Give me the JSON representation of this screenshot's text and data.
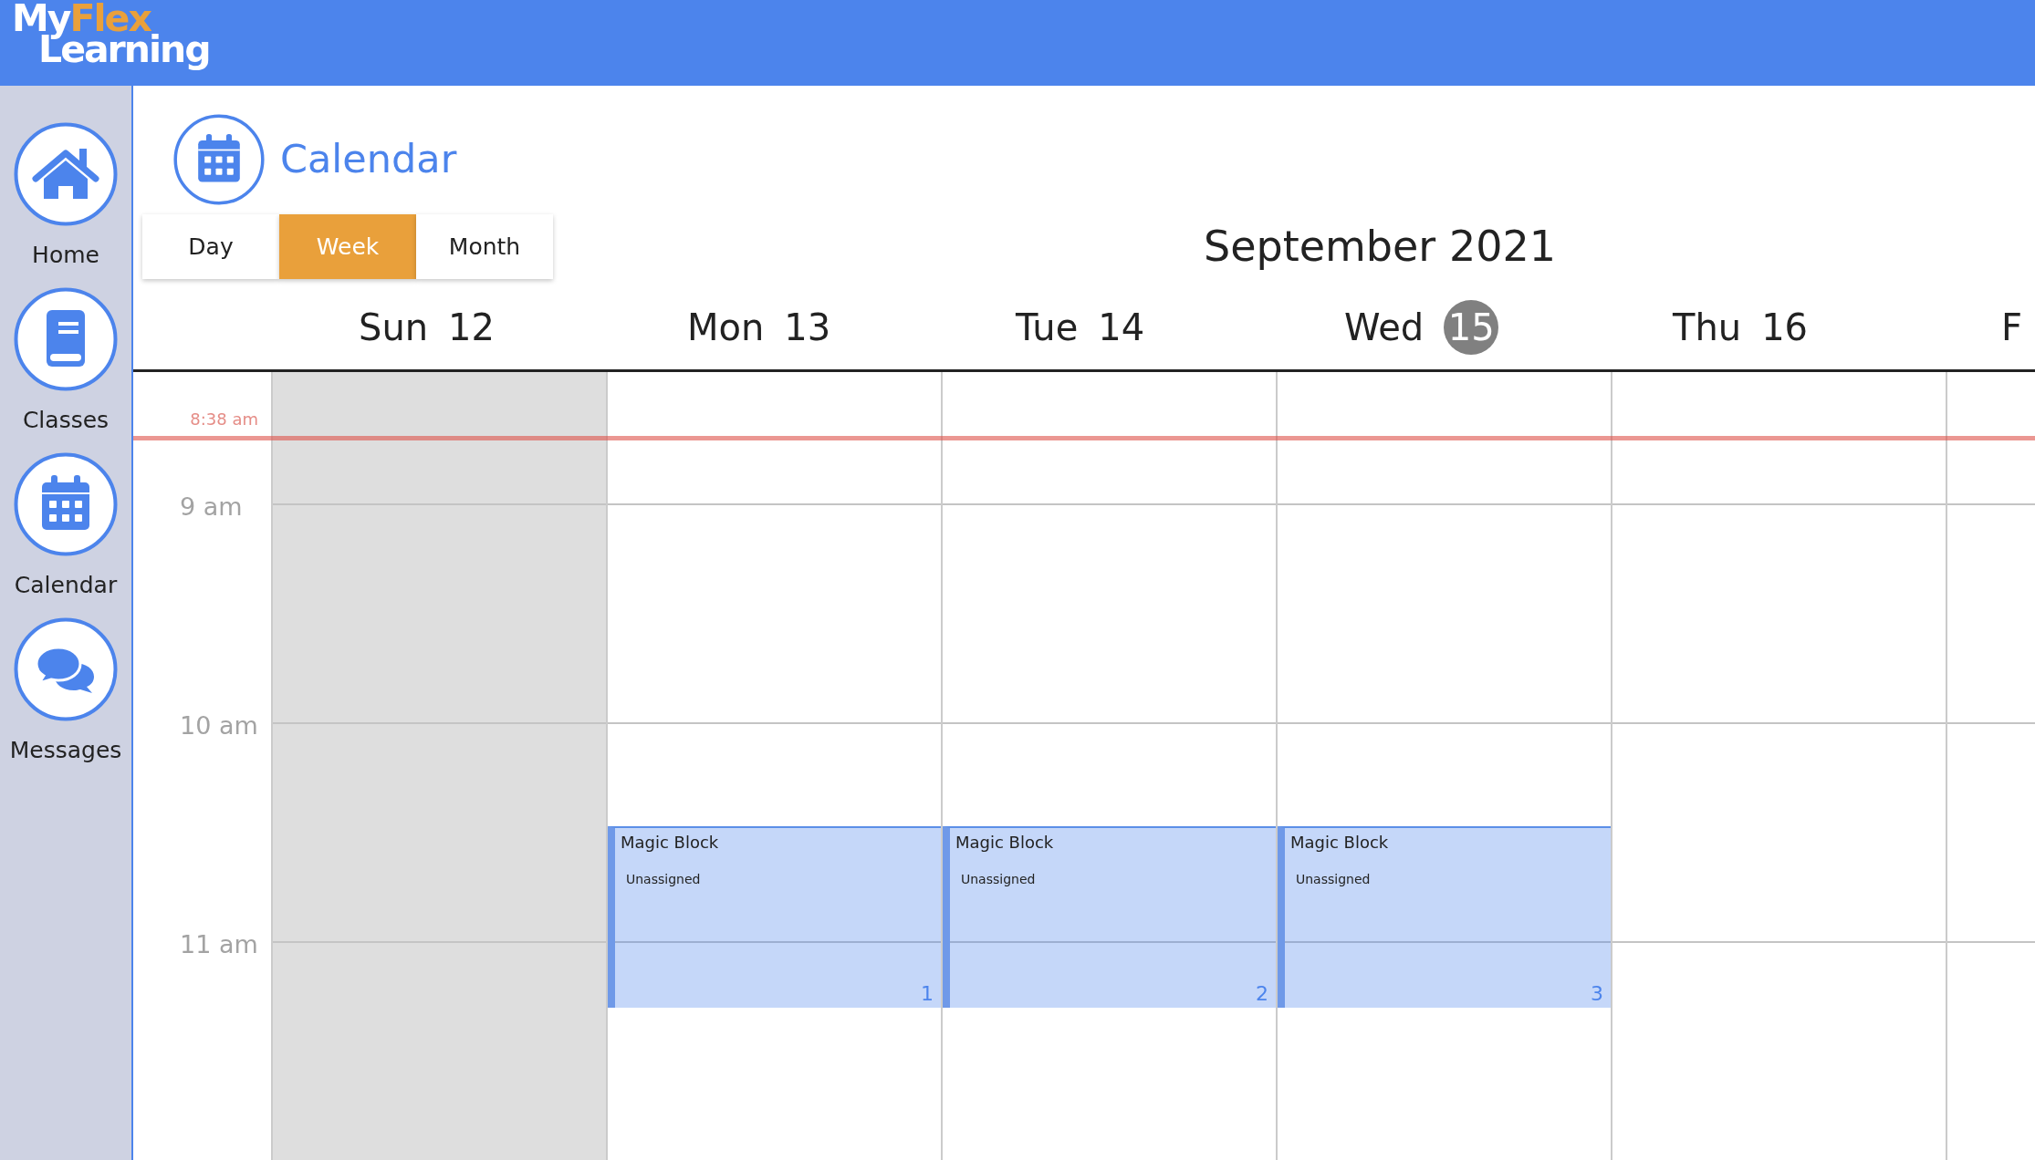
{
  "app_bar": {
    "logo": {
      "primary": "My",
      "accent": "Flex",
      "second_line": "Learning"
    }
  },
  "sidebar": {
    "items": [
      {
        "label": "Home"
      },
      {
        "label": "Classes"
      },
      {
        "label": "Calendar"
      },
      {
        "label": "Messages"
      }
    ]
  },
  "page_header": {
    "title": "Calendar"
  },
  "view_switcher": [
    {
      "label": "Day",
      "selected": false
    },
    {
      "label": "Week",
      "selected": true
    },
    {
      "label": "Month",
      "selected": false
    }
  ],
  "period_title": "September 2021",
  "days": [
    {
      "weekday": "Sun",
      "date": "12",
      "today": false,
      "past": true
    },
    {
      "weekday": "Mon",
      "date": "13",
      "today": false,
      "past": false,
      "events": [
        {
          "title": "Magic Block",
          "subtitle": "Unassigned",
          "number": "1"
        }
      ]
    },
    {
      "weekday": "Tue",
      "date": "14",
      "today": false,
      "past": false,
      "events": [
        {
          "title": "Magic Block",
          "subtitle": "Unassigned",
          "number": "2"
        }
      ]
    },
    {
      "weekday": "Wed",
      "date": "15",
      "today": true,
      "past": false,
      "events": [
        {
          "title": "Magic Block",
          "subtitle": "Unassigned",
          "number": "3"
        }
      ]
    },
    {
      "weekday": "Thu",
      "date": "16",
      "today": false,
      "past": false
    },
    {
      "weekday": "F",
      "today": false,
      "past": false
    }
  ],
  "time_axis": [
    "9 am",
    "10 am",
    "11 am"
  ],
  "now_indicator": {
    "label": "8:38 am"
  }
}
